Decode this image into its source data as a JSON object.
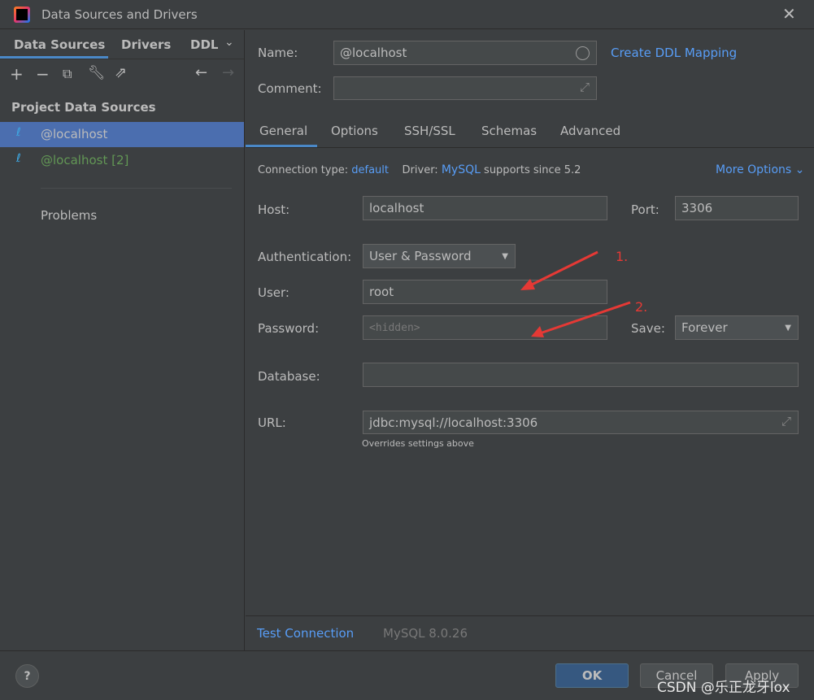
{
  "window": {
    "title": "Data Sources and Drivers"
  },
  "sidebar": {
    "tabs": [
      "Data Sources",
      "Drivers",
      "DDL"
    ],
    "section": "Project Data Sources",
    "items": [
      {
        "label": "@localhost",
        "selected": true
      },
      {
        "label": "@localhost [2]",
        "selected": false
      }
    ],
    "problems": "Problems"
  },
  "form": {
    "name_label": "Name:",
    "name_value": "@localhost",
    "create_ddl": "Create DDL Mapping",
    "comment_label": "Comment:",
    "comment_value": "",
    "tabs": [
      "General",
      "Options",
      "SSH/SSL",
      "Schemas",
      "Advanced"
    ],
    "conn_type_label": "Connection type:",
    "conn_type": "default",
    "driver_label": "Driver:",
    "driver": "MySQL",
    "driver_note": "supports since 5.2",
    "more_options": "More Options",
    "host_label": "Host:",
    "host": "localhost",
    "port_label": "Port:",
    "port": "3306",
    "auth_label": "Authentication:",
    "auth": "User & Password",
    "user_label": "User:",
    "user": "root",
    "password_label": "Password:",
    "password_placeholder": "<hidden>",
    "save_label": "Save:",
    "save": "Forever",
    "database_label": "Database:",
    "database": "",
    "url_label": "URL:",
    "url": "jdbc:mysql://localhost:3306",
    "url_note": "Overrides settings above"
  },
  "annotations": [
    "1.",
    "2."
  ],
  "bottom": {
    "test_connection": "Test Connection",
    "version": "MySQL 8.0.26"
  },
  "footer": {
    "ok": "OK",
    "cancel": "Cancel",
    "apply": "Apply",
    "help": "?"
  },
  "watermark": "CSDN @乐正龙牙lox",
  "colors": {
    "accent": "#589df6",
    "selection": "#4b6eaf",
    "arrow": "#e53935",
    "green": "#629755"
  }
}
